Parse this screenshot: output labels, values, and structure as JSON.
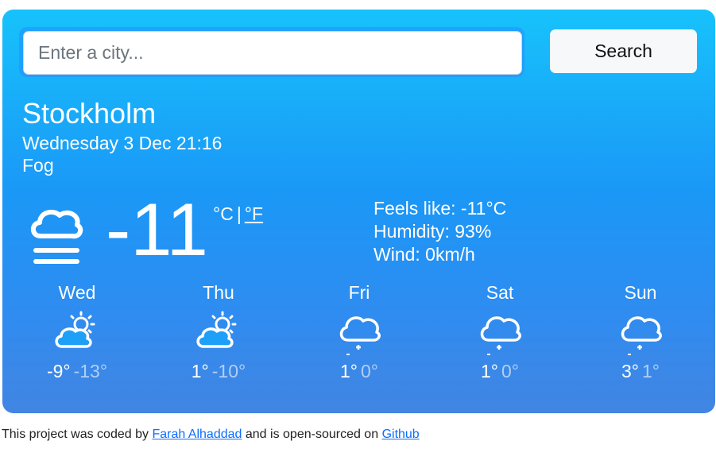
{
  "search": {
    "placeholder": "Enter a city...",
    "button_label": "Search"
  },
  "current": {
    "city": "Stockholm",
    "datetime": "Wednesday 3 Dec 21:16",
    "condition": "Fog",
    "icon": "fog-icon",
    "temperature": "-11",
    "unit_c": "°C",
    "unit_sep": "|",
    "unit_f": "°F",
    "feels_like": "Feels like: -11°C",
    "humidity": "Humidity: 93%",
    "wind": "Wind: 0km/h"
  },
  "forecast": [
    {
      "day": "Wed",
      "high": "-9°",
      "low": "-13°",
      "icon": "partly-cloudy-icon"
    },
    {
      "day": "Thu",
      "high": "1°",
      "low": "-10°",
      "icon": "partly-cloudy-icon"
    },
    {
      "day": "Fri",
      "high": "1°",
      "low": "0°",
      "icon": "snow-icon"
    },
    {
      "day": "Sat",
      "high": "1°",
      "low": "0°",
      "icon": "snow-icon"
    },
    {
      "day": "Sun",
      "high": "3°",
      "low": "1°",
      "icon": "snow-icon"
    }
  ],
  "footer": {
    "text1": "This project was coded by",
    "author": "Farah Alhaddad",
    "text2": "and is open-sourced on",
    "repo": "Github"
  }
}
